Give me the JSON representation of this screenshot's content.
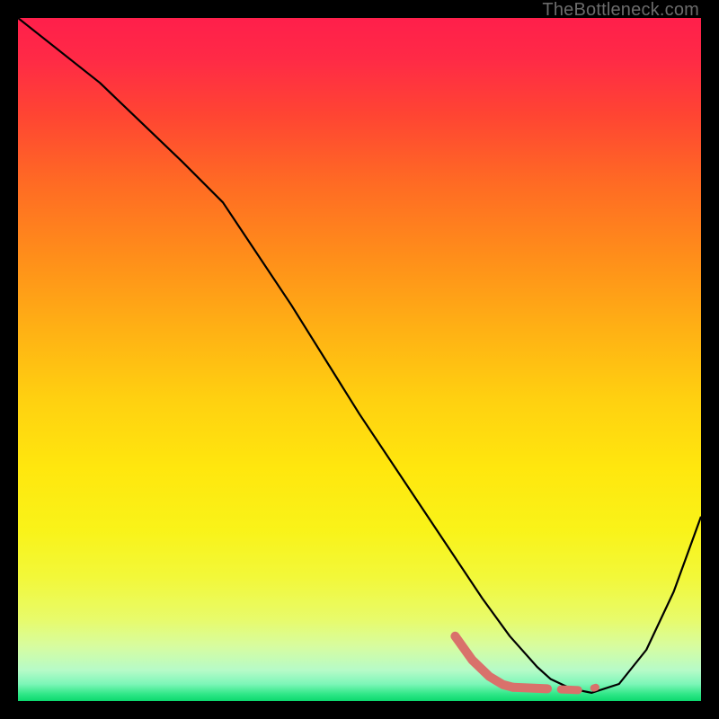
{
  "watermark": "TheBottleneck.com",
  "chart_data": {
    "type": "line",
    "title": "",
    "xlabel": "",
    "ylabel": "",
    "xlim": [
      0,
      100
    ],
    "ylim": [
      0,
      100
    ],
    "grid": false,
    "legend": false,
    "annotations": [],
    "gradient_stops": [
      {
        "offset": 0.0,
        "color": "#ff1f4b"
      },
      {
        "offset": 0.06,
        "color": "#ff2a46"
      },
      {
        "offset": 0.14,
        "color": "#ff4433"
      },
      {
        "offset": 0.24,
        "color": "#ff6a24"
      },
      {
        "offset": 0.35,
        "color": "#ff8e1a"
      },
      {
        "offset": 0.46,
        "color": "#ffb214"
      },
      {
        "offset": 0.56,
        "color": "#ffd110"
      },
      {
        "offset": 0.66,
        "color": "#ffe70e"
      },
      {
        "offset": 0.75,
        "color": "#f9f319"
      },
      {
        "offset": 0.82,
        "color": "#f2f83a"
      },
      {
        "offset": 0.88,
        "color": "#e8fb6a"
      },
      {
        "offset": 0.92,
        "color": "#d7fca0"
      },
      {
        "offset": 0.955,
        "color": "#b6fbc8"
      },
      {
        "offset": 0.975,
        "color": "#7df6b8"
      },
      {
        "offset": 0.99,
        "color": "#2fe787"
      },
      {
        "offset": 1.0,
        "color": "#0cd96e"
      }
    ],
    "series": [
      {
        "name": "curve",
        "color": "#000000",
        "stroke_width": 2.2,
        "x": [
          0,
          12,
          24,
          30,
          40,
          50,
          58,
          64,
          68,
          72,
          76,
          78,
          81,
          84,
          88,
          92,
          96,
          100
        ],
        "y": [
          100,
          90.5,
          79,
          73,
          58,
          42,
          30,
          21,
          15,
          9.5,
          5,
          3.2,
          1.8,
          1.2,
          2.5,
          7.5,
          16,
          27
        ]
      },
      {
        "name": "highlight-segment-1",
        "color": "#d9716b",
        "stroke_width": 10,
        "linecap": "round",
        "x": [
          64,
          66.5,
          69,
          71,
          72.5
        ],
        "y": [
          9.5,
          6.0,
          3.6,
          2.4,
          2.0
        ]
      },
      {
        "name": "highlight-segment-2",
        "color": "#d9716b",
        "stroke_width": 10,
        "linecap": "round",
        "x": [
          72.5,
          77.5
        ],
        "y": [
          2.0,
          1.8
        ]
      },
      {
        "name": "highlight-dash-1",
        "color": "#d9716b",
        "stroke_width": 9,
        "linecap": "round",
        "x": [
          79.5,
          82.0
        ],
        "y": [
          1.7,
          1.6
        ]
      },
      {
        "name": "highlight-dot-1",
        "color": "#d9716b",
        "stroke_width": 8,
        "linecap": "round",
        "x": [
          84.3,
          84.6
        ],
        "y": [
          1.9,
          2.0
        ]
      }
    ]
  }
}
